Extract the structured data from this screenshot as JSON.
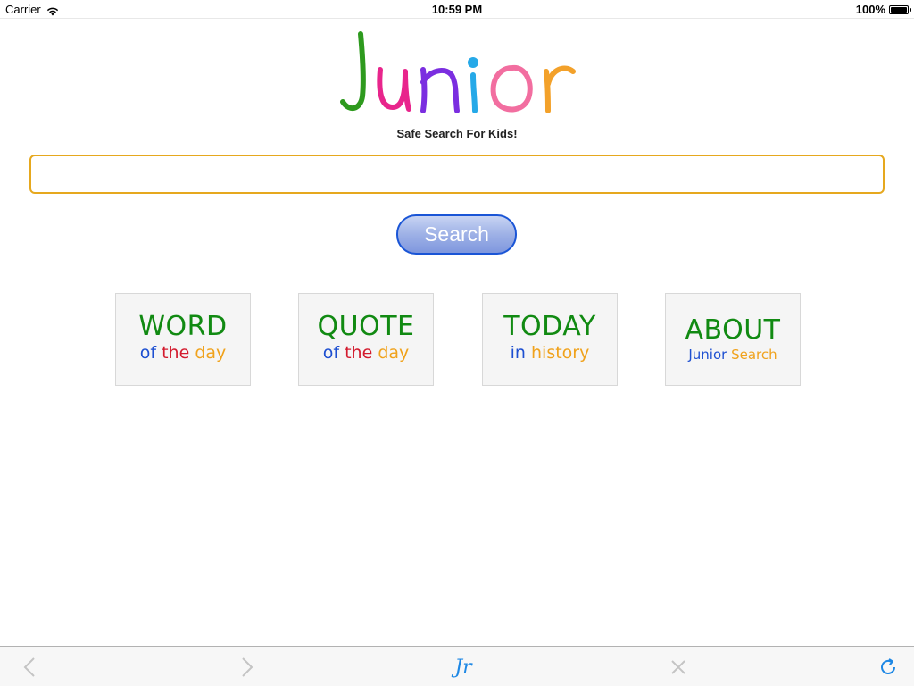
{
  "status_bar": {
    "carrier": "Carrier",
    "time": "10:59 PM",
    "battery": "100%"
  },
  "logo": {
    "text": "Junior",
    "letter_colors": [
      "#2e9a1e",
      "#e8258c",
      "#7b2ee0",
      "#26a9e8",
      "#f26ea0",
      "#f3a12a"
    ]
  },
  "tagline": "Safe Search For Kids!",
  "search": {
    "value": "",
    "placeholder": "",
    "button_label": "Search"
  },
  "tiles": [
    {
      "title": "WORD",
      "sub": [
        "of",
        "the",
        "day"
      ]
    },
    {
      "title": "QUOTE",
      "sub": [
        "of",
        "the",
        "day"
      ]
    },
    {
      "title": "TODAY",
      "sub": [
        "in",
        "history"
      ]
    },
    {
      "title": "ABOUT",
      "sub": [
        "Junior",
        "Search"
      ]
    }
  ],
  "toolbar": {
    "home_label": "Jr",
    "icons": [
      "chevron-left-icon",
      "chevron-right-icon",
      "close-icon",
      "reload-icon"
    ]
  },
  "colors": {
    "accent_green": "#118a12",
    "accent_blue": "#1d4fd1",
    "accent_red": "#d31b2e",
    "accent_orange": "#f0a21c",
    "search_border": "#e6a81e",
    "button_border": "#1a55d6",
    "toolbar_tint": "#1e88e5"
  }
}
